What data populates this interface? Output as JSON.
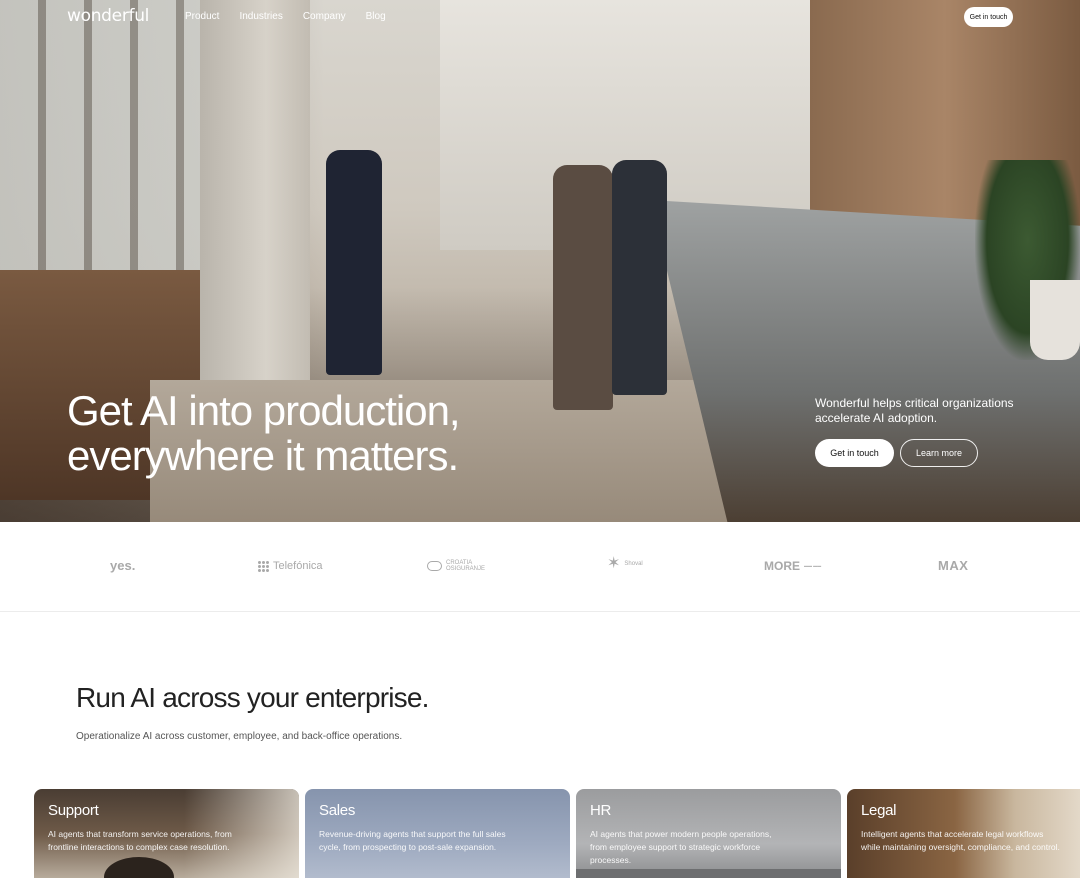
{
  "nav": {
    "logo": "wonderful",
    "links": [
      "Product",
      "Industries",
      "Company",
      "Blog"
    ],
    "cta": "Get in touch"
  },
  "hero": {
    "title_line1": "Get AI into production,",
    "title_line2": "everywhere it matters.",
    "tagline": "Wonderful helps critical organizations accelerate AI adoption.",
    "primary_button": "Get in touch",
    "secondary_button": "Learn more"
  },
  "clients": {
    "yes": "yes.",
    "telefonica": "Telefónica",
    "croatia_line1": "CROATIA",
    "croatia_line2": "OSIGURANJE",
    "shoval": "Shoval",
    "more": "MORE",
    "max": "MAX"
  },
  "enterprise": {
    "title": "Run AI across your enterprise.",
    "subtitle": "Operationalize AI across customer, employee, and back-office operations.",
    "cards": [
      {
        "title": "Support",
        "description": "AI agents that transform service operations, from frontline interactions to complex case resolution."
      },
      {
        "title": "Sales",
        "description": "Revenue-driving agents that support the full sales cycle, from prospecting to post-sale expansion."
      },
      {
        "title": "HR",
        "description": "AI agents that power modern people operations, from employee support to strategic workforce processes."
      },
      {
        "title": "Legal",
        "description": "Intelligent agents that accelerate legal workflows while maintaining oversight, compliance, and control."
      }
    ]
  },
  "colors": {
    "accent_text": "#ffffff",
    "logo_gray": "#a9a9a9",
    "heading": "#222222"
  }
}
